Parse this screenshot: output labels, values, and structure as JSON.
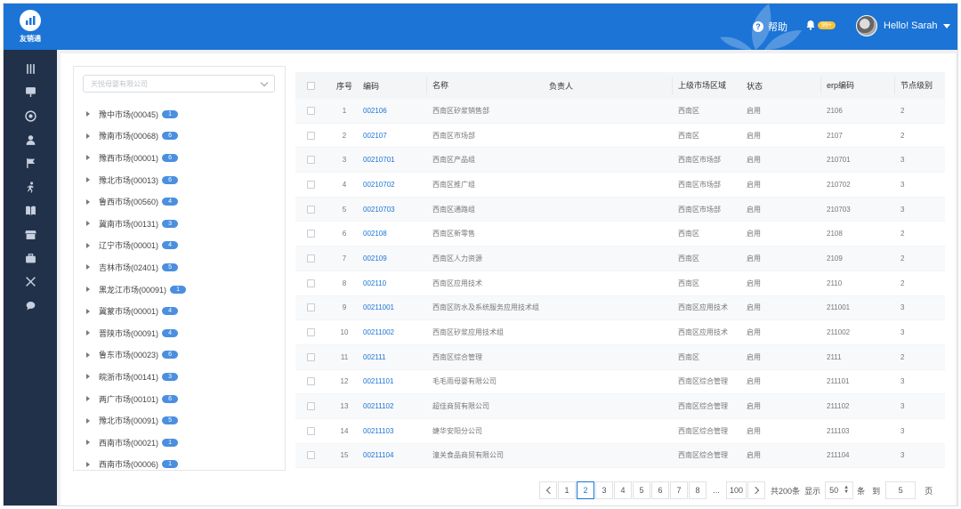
{
  "app": {
    "logo_text": "友销通"
  },
  "header": {
    "help_label": "帮助",
    "notification_count": "99+",
    "user_greeting": "Hello! Sarah"
  },
  "tree": {
    "select_placeholder": "天悦母婴有限公司",
    "items": [
      {
        "label": "豫中市场(00045)",
        "count": "1"
      },
      {
        "label": "豫南市场(00068)",
        "count": "6"
      },
      {
        "label": "豫西市场(00001)",
        "count": "6"
      },
      {
        "label": "豫北市场(00013)",
        "count": "6"
      },
      {
        "label": "鲁西市场(00560)",
        "count": "4"
      },
      {
        "label": "冀南市场(00131)",
        "count": "3"
      },
      {
        "label": "辽宁市场(00001)",
        "count": "4"
      },
      {
        "label": "吉林市场(02401)",
        "count": "5"
      },
      {
        "label": "黑龙江市场(00091)",
        "count": "1"
      },
      {
        "label": "冀蒙市场(00001)",
        "count": "4"
      },
      {
        "label": "晋陕市场(00091)",
        "count": "4"
      },
      {
        "label": "鲁东市场(00023)",
        "count": "6"
      },
      {
        "label": "皖浙市场(00141)",
        "count": "3"
      },
      {
        "label": "两广市场(00101)",
        "count": "6"
      },
      {
        "label": "豫北市场(00091)",
        "count": "5"
      },
      {
        "label": "西南市场(00021)",
        "count": "1"
      },
      {
        "label": "西南市场(00006)",
        "count": "1"
      }
    ]
  },
  "table": {
    "headers": {
      "index": "序号",
      "code": "编码",
      "name": "名称",
      "manager": "负责人",
      "parent": "上级市场区域",
      "status": "状态",
      "erp": "erp编码",
      "level": "节点级别"
    },
    "rows": [
      {
        "index": "1",
        "code": "002106",
        "name": "西南区矽浆销售部",
        "manager": "",
        "parent": "西南区",
        "status": "启用",
        "erp": "2106",
        "level": "2"
      },
      {
        "index": "2",
        "code": "002107",
        "name": "西南区市场部",
        "manager": "",
        "parent": "西南区",
        "status": "启用",
        "erp": "2107",
        "level": "2"
      },
      {
        "index": "3",
        "code": "00210701",
        "name": "西南区产品组",
        "manager": "",
        "parent": "西南区市场部",
        "status": "启用",
        "erp": "210701",
        "level": "3"
      },
      {
        "index": "4",
        "code": "00210702",
        "name": "西南区推广组",
        "manager": "",
        "parent": "西南区市场部",
        "status": "启用",
        "erp": "210702",
        "level": "3"
      },
      {
        "index": "5",
        "code": "00210703",
        "name": "西南区通路组",
        "manager": "",
        "parent": "西南区市场部",
        "status": "启用",
        "erp": "210703",
        "level": "3"
      },
      {
        "index": "6",
        "code": "002108",
        "name": "西南区新零售",
        "manager": "",
        "parent": "西南区",
        "status": "启用",
        "erp": "2108",
        "level": "2"
      },
      {
        "index": "7",
        "code": "002109",
        "name": "西南区人力资源",
        "manager": "",
        "parent": "西南区",
        "status": "启用",
        "erp": "2109",
        "level": "2"
      },
      {
        "index": "8",
        "code": "002110",
        "name": "西南区应用技术",
        "manager": "",
        "parent": "西南区",
        "status": "启用",
        "erp": "2110",
        "level": "2"
      },
      {
        "index": "9",
        "code": "00211001",
        "name": "西南区防水及系统服务应用技术组",
        "manager": "",
        "parent": "西南区应用技术",
        "status": "启用",
        "erp": "211001",
        "level": "3"
      },
      {
        "index": "10",
        "code": "00211002",
        "name": "西南区矽浆应用技术组",
        "manager": "",
        "parent": "西南区应用技术",
        "status": "启用",
        "erp": "211002",
        "level": "3"
      },
      {
        "index": "11",
        "code": "002111",
        "name": "西南区综合管理",
        "manager": "",
        "parent": "西南区",
        "status": "启用",
        "erp": "2111",
        "level": "2"
      },
      {
        "index": "12",
        "code": "00211101",
        "name": "毛毛雨母婴有限公司",
        "manager": "",
        "parent": "西南区综合管理",
        "status": "启用",
        "erp": "211101",
        "level": "3"
      },
      {
        "index": "13",
        "code": "00211102",
        "name": "超佳商贸有限公司",
        "manager": "",
        "parent": "西南区综合管理",
        "status": "启用",
        "erp": "211102",
        "level": "3"
      },
      {
        "index": "14",
        "code": "00211103",
        "name": "婕华安阳分公司",
        "manager": "",
        "parent": "西南区综合管理",
        "status": "启用",
        "erp": "211103",
        "level": "3"
      },
      {
        "index": "15",
        "code": "00211104",
        "name": "潼关食品商贸有限公司",
        "manager": "",
        "parent": "西南区综合管理",
        "status": "启用",
        "erp": "211104",
        "level": "3"
      }
    ]
  },
  "pagination": {
    "pages": [
      "1",
      "2",
      "3",
      "4",
      "5",
      "6",
      "7",
      "8"
    ],
    "active_page": "2",
    "ellipsis": "...",
    "last_page": "100",
    "total_text": "共200条",
    "show_label": "显示",
    "page_size": "50",
    "per_unit": "条",
    "goto_label": "到",
    "goto_value": "5",
    "page_unit": "页"
  }
}
